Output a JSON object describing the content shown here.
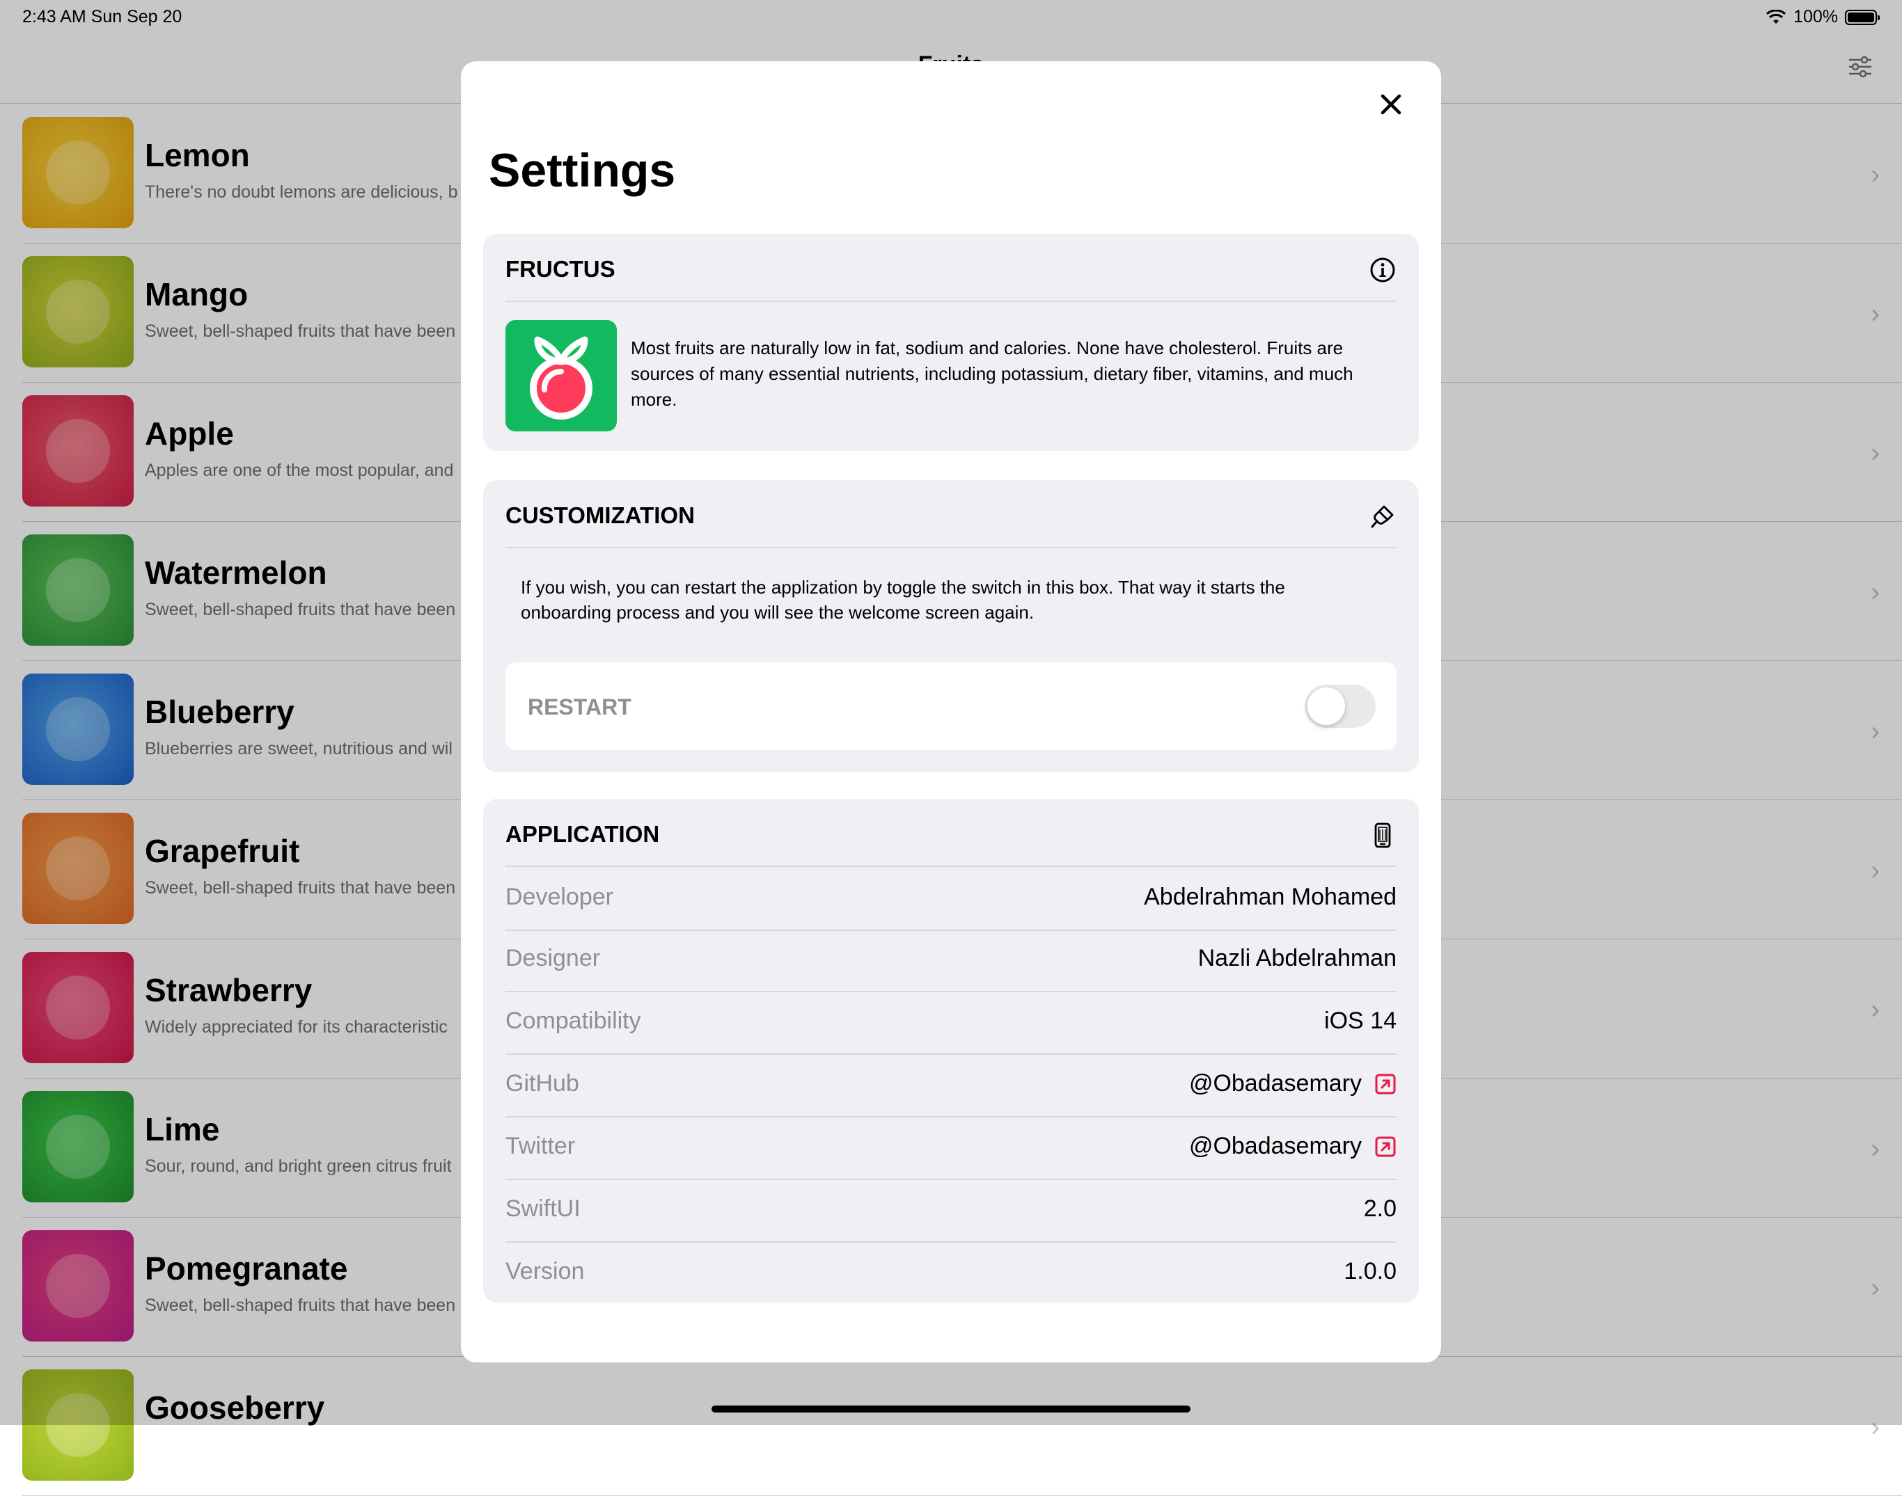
{
  "status_bar": {
    "time": "2:43 AM   Sun Sep 20",
    "battery": "100%"
  },
  "nav": {
    "title": "Fruits"
  },
  "fruits": [
    {
      "name": "Lemon",
      "desc": "There's no doubt lemons are delicious, b",
      "c1": "#f7d33b",
      "c2": "#e6a212"
    },
    {
      "name": "Mango",
      "desc": "Sweet, bell-shaped fruits that have been",
      "c1": "#d6d43a",
      "c2": "#8fae1b"
    },
    {
      "name": "Apple",
      "desc": "Apples are one of the most popular, and",
      "c1": "#f05a6c",
      "c2": "#d11f45"
    },
    {
      "name": "Watermelon",
      "desc": "Sweet, bell-shaped fruits that have been",
      "c1": "#5cc85a",
      "c2": "#2f8f3a"
    },
    {
      "name": "Blueberry",
      "desc": "Blueberries are sweet, nutritious and wil",
      "c1": "#4fa6ea",
      "c2": "#1f5fcb"
    },
    {
      "name": "Grapefruit",
      "desc": "Sweet, bell-shaped fruits that have been",
      "c1": "#f39a4a",
      "c2": "#e06a24"
    },
    {
      "name": "Strawberry",
      "desc": "Widely appreciated for its characteristic",
      "c1": "#f04a78",
      "c2": "#d0154b"
    },
    {
      "name": "Lime",
      "desc": "Sour, round, and bright green citrus fruit",
      "c1": "#3fcc4a",
      "c2": "#1e8f2c"
    },
    {
      "name": "Pomegranate",
      "desc": "Sweet, bell-shaped fruits that have been",
      "c1": "#e8407a",
      "c2": "#bf1d8b"
    },
    {
      "name": "Gooseberry",
      "desc": "",
      "c1": "#c4d63a",
      "c2": "#8fb21c"
    }
  ],
  "settings": {
    "title": "Settings",
    "fructus": {
      "label": "FRUCTUS",
      "about": "Most fruits are naturally low in fat, sodium and calories. None have cholesterol. Fruits are sources of many essential nutrients, including potassium, dietary fiber, vitamins, and much more."
    },
    "customization": {
      "label": "CUSTOMIZATION",
      "text": "If you wish, you can restart the applization by toggle the switch in this box. That way it starts the onboarding process and you will see the welcome screen again.",
      "restart_label": "RESTART",
      "restart_on": false
    },
    "application": {
      "label": "APPLICATION",
      "rows": [
        {
          "key": "Developer",
          "value": "Abdelrahman Mohamed",
          "link": false
        },
        {
          "key": "Designer",
          "value": "Nazli Abdelrahman",
          "link": false
        },
        {
          "key": "Compatibility",
          "value": "iOS 14",
          "link": false
        },
        {
          "key": "GitHub",
          "value": "@Obadasemary",
          "link": true
        },
        {
          "key": "Twitter",
          "value": "@Obadasemary",
          "link": true
        },
        {
          "key": "SwiftUI",
          "value": "2.0",
          "link": false
        },
        {
          "key": "Version",
          "value": "1.0.0",
          "link": false
        }
      ]
    },
    "accent_color": "#e6194b"
  }
}
